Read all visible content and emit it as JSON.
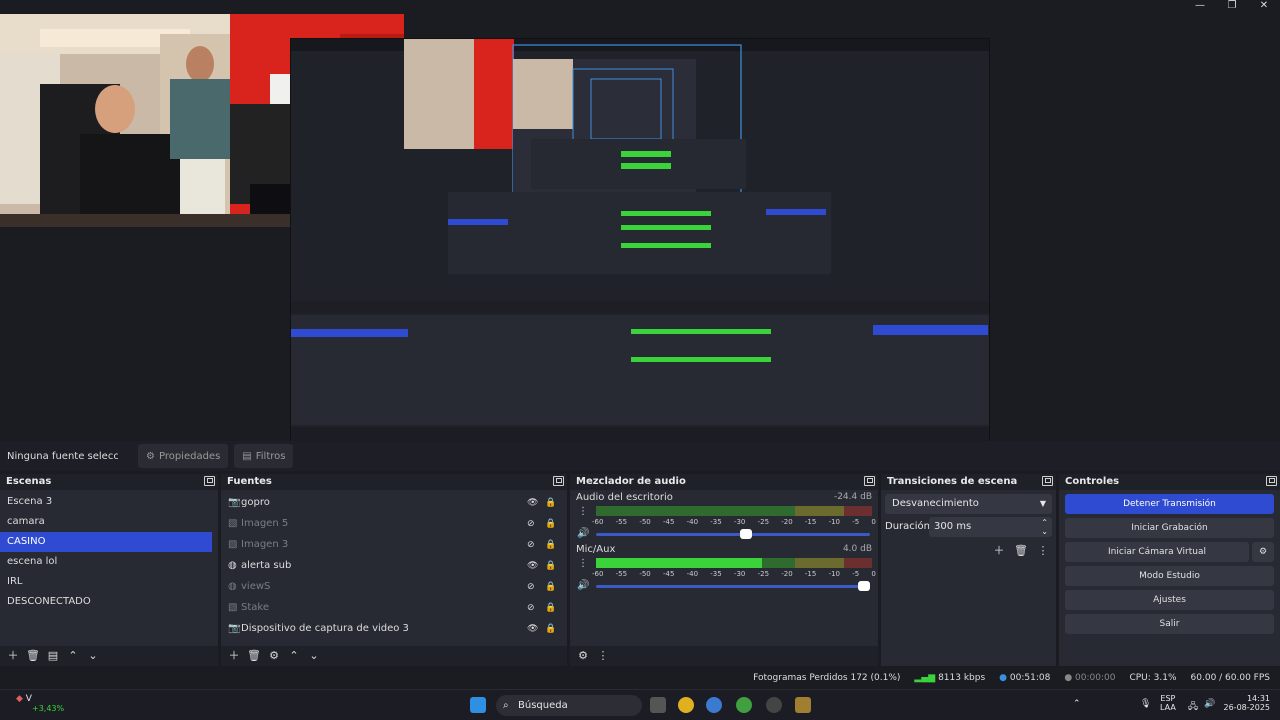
{
  "window": {
    "minimize": "—",
    "maximize": "❐",
    "close": "✕"
  },
  "source_bar": {
    "no_source": "Ninguna fuente seleccionada",
    "properties": "Propiedades",
    "filters": "Filtros"
  },
  "scenes": {
    "title": "Escenas",
    "items": [
      "Escena 3",
      "camara",
      "CASINO",
      "escena lol",
      "IRL",
      "DESCONECTADO"
    ],
    "active": "CASINO"
  },
  "sources": {
    "title": "Fuentes",
    "items": [
      {
        "name": "gopro",
        "visible": true,
        "icon": "camera-icon"
      },
      {
        "name": "Imagen 5",
        "visible": false,
        "icon": "image-icon"
      },
      {
        "name": "Imagen 3",
        "visible": false,
        "icon": "image-icon"
      },
      {
        "name": "alerta sub",
        "visible": true,
        "icon": "globe-icon"
      },
      {
        "name": "viewS",
        "visible": false,
        "icon": "globe-icon"
      },
      {
        "name": "Stake",
        "visible": false,
        "icon": "image-icon"
      },
      {
        "name": "Dispositivo de captura de video 3",
        "visible": true,
        "icon": "camera-icon"
      }
    ]
  },
  "mixer": {
    "title": "Mezclador de audio",
    "channels": [
      {
        "name": "Audio del escritorio",
        "db": "-24.4 dB",
        "level": 0.57
      },
      {
        "name": "Mic/Aux",
        "db": "4.0 dB",
        "level": 1.0
      }
    ],
    "ticks": [
      "-60",
      "-55",
      "-50",
      "-45",
      "-40",
      "-35",
      "-30",
      "-25",
      "-20",
      "-15",
      "-10",
      "-5",
      "0"
    ]
  },
  "transitions": {
    "title": "Transiciones de escena",
    "selected": "Desvanecimiento",
    "duration_label": "Duración",
    "duration_value": "300 ms"
  },
  "controls": {
    "title": "Controles",
    "stop_stream": "Detener Transmisión",
    "start_recording": "Iniciar Grabación",
    "virtual_camera": "Iniciar Cámara Virtual",
    "studio_mode": "Modo Estudio",
    "settings": "Ajustes",
    "exit": "Salir"
  },
  "status": {
    "dropped_frames": "Fotogramas Perdidos 172 (0.1%)",
    "bitrate": "8113 kbps",
    "stream_time": "00:51:08",
    "record_time": "00:00:00",
    "cpu": "CPU: 3.1%",
    "fps": "60.00 / 60.00 FPS"
  },
  "taskbar": {
    "widget_ticker": "V",
    "widget_change": "+3,43%",
    "search": "Búsqueda",
    "lang_top": "ESP",
    "lang_bottom": "LAA",
    "time": "14:31",
    "date": "26-08-2025"
  },
  "colors": {
    "accent": "#2f4bd1",
    "meter_green": "#3ad43a",
    "meter_yellow": "#c8c83a",
    "meter_red": "#d43a3a"
  }
}
